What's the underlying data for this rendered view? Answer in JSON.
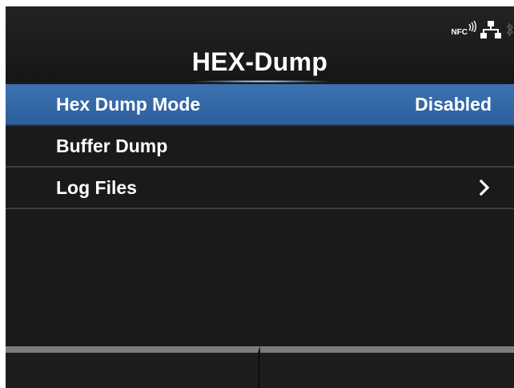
{
  "header": {
    "title": "HEX-Dump",
    "status": {
      "nfc_label": "NFC",
      "icons": [
        "nfc-icon",
        "network-icon",
        "bluetooth-icon"
      ]
    }
  },
  "menu": {
    "items": [
      {
        "label": "Hex Dump Mode",
        "value": "Disabled",
        "selected": true
      },
      {
        "label": "Buffer Dump",
        "value": ""
      },
      {
        "label": "Log Files",
        "value": "",
        "has_submenu": true
      }
    ]
  },
  "footer": {
    "softkeys": [
      "",
      ""
    ]
  },
  "colors": {
    "background": "#1b1b1b",
    "selected_row": "#356aa8",
    "text": "#ffffff",
    "divider": "#3e3e3e",
    "softkey_bar": "#7d7d7d"
  }
}
